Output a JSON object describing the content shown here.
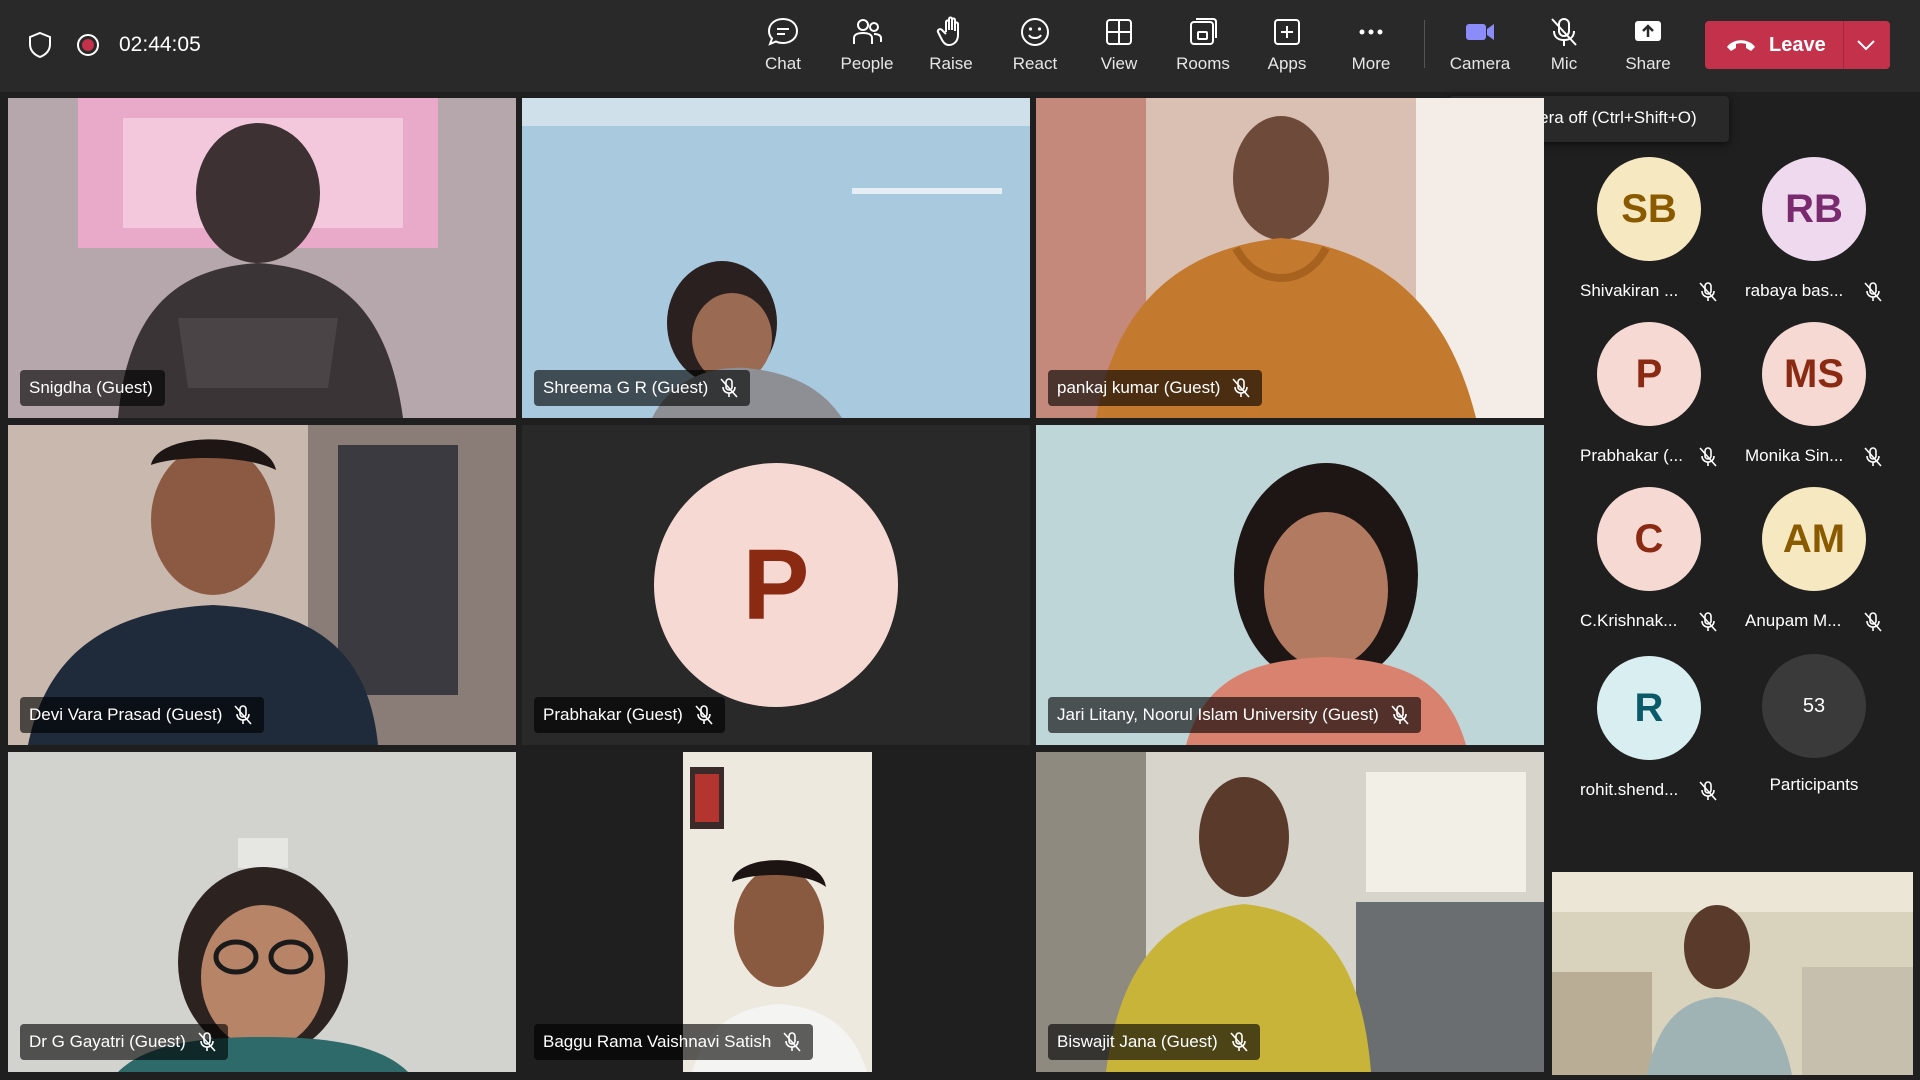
{
  "meeting": {
    "timer": "02:44:05"
  },
  "toolbar": {
    "chat": "Chat",
    "people": "People",
    "raise": "Raise",
    "react": "React",
    "view": "View",
    "rooms": "Rooms",
    "apps": "Apps",
    "more": "More",
    "camera": "Camera",
    "mic": "Mic",
    "share": "Share",
    "leave": "Leave"
  },
  "tooltip": "Turn camera off (Ctrl+Shift+O)",
  "tiles": [
    {
      "name": "Snigdha (Guest)"
    },
    {
      "name": "Shreema G R (Guest)"
    },
    {
      "name": "pankaj kumar (Guest)"
    },
    {
      "name": "Devi Vara Prasad (Guest)"
    },
    {
      "name": "Prabhakar (Guest)",
      "initial": "P"
    },
    {
      "name": "Jari Litany, Noorul Islam University (Guest)"
    },
    {
      "name": "Dr G Gayatri (Guest)"
    },
    {
      "name": "Baggu Rama Vaishnavi Satish"
    },
    {
      "name": "Biswajit Jana (Guest)"
    }
  ],
  "participants": [
    {
      "initials": "SB",
      "name": "Shivakiran ...",
      "bg": "#f6e8c1",
      "fg": "#8a5a00"
    },
    {
      "initials": "RB",
      "name": "rabaya bas...",
      "bg": "#efd9ee",
      "fg": "#7a2a6e"
    },
    {
      "initials": "P",
      "name": "Prabhakar (...",
      "bg": "#f6d9d2",
      "fg": "#8a2a12"
    },
    {
      "initials": "MS",
      "name": "Monika Sin...",
      "bg": "#f6d9d2",
      "fg": "#8a2a12"
    },
    {
      "initials": "C",
      "name": "C.Krishnak...",
      "bg": "#f6d9d2",
      "fg": "#8a2a12"
    },
    {
      "initials": "AM",
      "name": "Anupam M...",
      "bg": "#f6e8c1",
      "fg": "#8a5a00"
    },
    {
      "initials": "R",
      "name": "rohit.shend...",
      "bg": "#d9eef1",
      "fg": "#0b5a6a"
    }
  ],
  "participants_count": {
    "value": "53",
    "label": "Participants"
  },
  "colors": {
    "leave": "#c4314b",
    "camera_active": "#8b8cf9",
    "recording": "#c4314b"
  }
}
